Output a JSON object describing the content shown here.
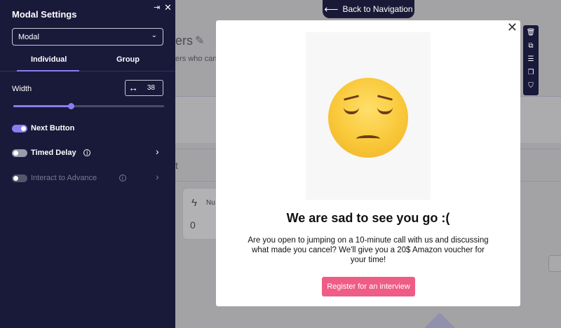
{
  "background": {
    "title_fragment": "ers",
    "subtitle_fragment": "ers who canc",
    "section_fragment": "t",
    "card": {
      "label_fragment": "Nu",
      "value": "0"
    }
  },
  "back_nav": {
    "label": "Back to Navigation",
    "icon": "arrow-left-icon"
  },
  "panel": {
    "title": "Modal Settings",
    "select": {
      "value": "Modal"
    },
    "tabs": [
      {
        "label": "Individual",
        "active": true
      },
      {
        "label": "Group",
        "active": false
      }
    ],
    "width": {
      "label": "Width",
      "value": "38",
      "slider_fraction": 0.38
    },
    "options": [
      {
        "label": "Next Button",
        "enabled": true,
        "disabled": false,
        "has_info": false,
        "has_chevron": false
      },
      {
        "label": "Timed Delay",
        "enabled": false,
        "disabled": false,
        "has_info": true,
        "has_chevron": true
      },
      {
        "label": "Interact to Advance",
        "enabled": false,
        "disabled": true,
        "has_info": true,
        "has_chevron": true
      }
    ],
    "colors": {
      "background": "#19193a",
      "accent": "#8a7df0"
    }
  },
  "toolbar": {
    "icons": [
      "trash-icon",
      "copy-icon",
      "sliders-icon",
      "duplicate-icon",
      "bookmark-icon"
    ]
  },
  "modal": {
    "image_icon": "pensive-face-emoji",
    "heading": "We are sad to see you go :(",
    "body": "Are you open to jumping on a 10-minute call with us and discussing what made you cancel? We'll give you a 20$ Amazon voucher for your time!",
    "button_label": "Register for an interview",
    "colors": {
      "button": "#ef5c86"
    }
  }
}
